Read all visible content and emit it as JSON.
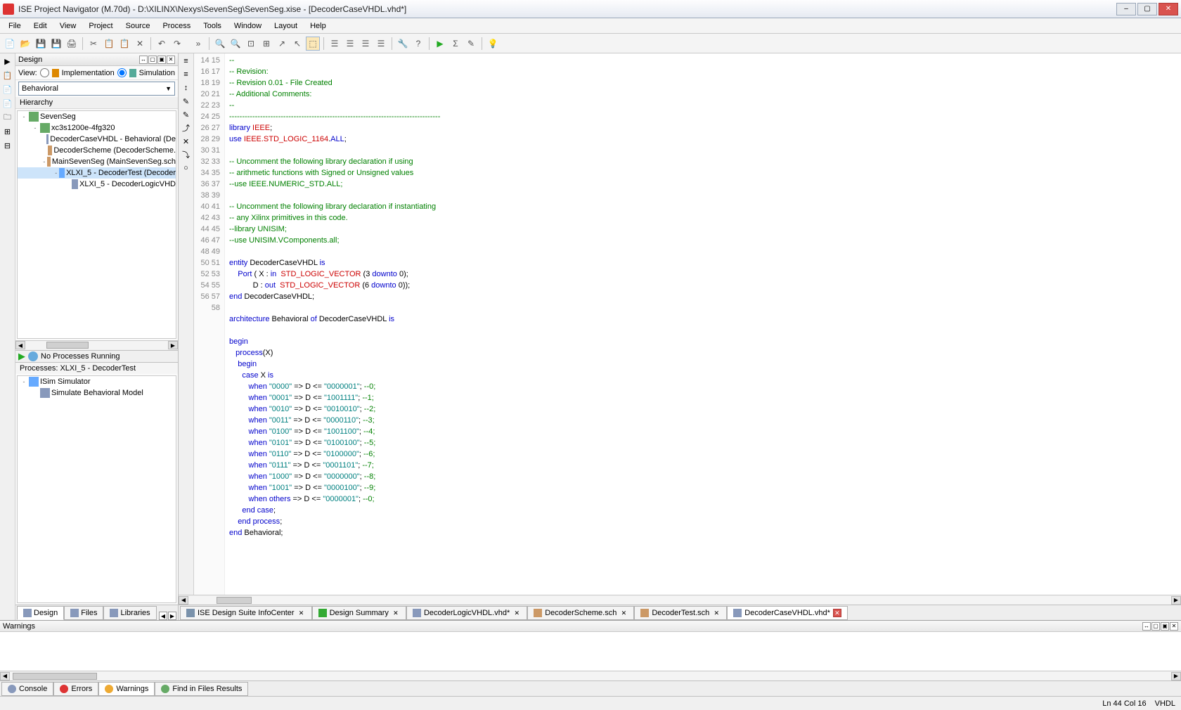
{
  "title": "ISE Project Navigator (M.70d) - D:\\XILINX\\Nexys\\SevenSeg\\SevenSeg.xise - [DecoderCaseVHDL.vhd*]",
  "menu": [
    "File",
    "Edit",
    "View",
    "Project",
    "Source",
    "Process",
    "Tools",
    "Window",
    "Layout",
    "Help"
  ],
  "design_panel": {
    "title": "Design",
    "view_label": "View:",
    "impl": "Implementation",
    "sim": "Simulation",
    "combo": "Behavioral",
    "hierarchy": "Hierarchy",
    "tree": [
      {
        "indent": 0,
        "exp": "-",
        "ico": "chip",
        "label": "SevenSeg"
      },
      {
        "indent": 1,
        "exp": "-",
        "ico": "chip",
        "label": "xc3s1200e-4fg320"
      },
      {
        "indent": 2,
        "exp": "",
        "ico": "doc",
        "label": "DecoderCaseVHDL - Behavioral (De"
      },
      {
        "indent": 2,
        "exp": "",
        "ico": "sch",
        "label": "DecoderScheme (DecoderScheme."
      },
      {
        "indent": 2,
        "exp": "-",
        "ico": "sch",
        "label": "MainSevenSeg (MainSevenSeg.sch"
      },
      {
        "indent": 3,
        "exp": "-",
        "ico": "mod",
        "label": "XLXI_5 - DecoderTest (Decoder",
        "sel": true
      },
      {
        "indent": 4,
        "exp": "",
        "ico": "doc",
        "label": "XLXI_5 - DecoderLogicVHD"
      }
    ],
    "no_proc": "No Processes Running",
    "proc_label": "Processes: XLXI_5 - DecoderTest",
    "proc_tree": [
      {
        "indent": 0,
        "exp": "-",
        "ico": "mod",
        "label": "ISim Simulator"
      },
      {
        "indent": 1,
        "exp": "",
        "ico": "doc",
        "label": "Simulate Behavioral Model"
      }
    ],
    "tabs": [
      "Design",
      "Files",
      "Libraries"
    ]
  },
  "code_lines": [
    {
      "n": 14,
      "t": "--",
      "cls": "cmt"
    },
    {
      "n": 15,
      "t": "-- Revision:",
      "cls": "cmt"
    },
    {
      "n": 16,
      "t": "-- Revision 0.01 - File Created",
      "cls": "cmt"
    },
    {
      "n": 17,
      "t": "-- Additional Comments:",
      "cls": "cmt"
    },
    {
      "n": 18,
      "t": "--",
      "cls": "cmt"
    },
    {
      "n": 19,
      "t": "----------------------------------------------------------------------------------",
      "cls": "cmt"
    },
    {
      "n": 20,
      "html": "<span class='kw'>library</span> <span class='lib'>IEEE</span>;"
    },
    {
      "n": 21,
      "html": "<span class='kw'>use</span> <span class='lib'>IEEE.STD_LOGIC_1164</span>.<span class='kw'>ALL</span>;"
    },
    {
      "n": 22,
      "t": ""
    },
    {
      "n": 23,
      "t": "-- Uncomment the following library declaration if using",
      "cls": "cmt"
    },
    {
      "n": 24,
      "t": "-- arithmetic functions with Signed or Unsigned values",
      "cls": "cmt"
    },
    {
      "n": 25,
      "t": "--use IEEE.NUMERIC_STD.ALL;",
      "cls": "cmt"
    },
    {
      "n": 26,
      "t": ""
    },
    {
      "n": 27,
      "t": "-- Uncomment the following library declaration if instantiating",
      "cls": "cmt"
    },
    {
      "n": 28,
      "t": "-- any Xilinx primitives in this code.",
      "cls": "cmt"
    },
    {
      "n": 29,
      "t": "--library UNISIM;",
      "cls": "cmt"
    },
    {
      "n": 30,
      "t": "--use UNISIM.VComponents.all;",
      "cls": "cmt"
    },
    {
      "n": 31,
      "t": ""
    },
    {
      "n": 32,
      "html": "<span class='kw'>entity</span> DecoderCaseVHDL <span class='kw'>is</span>"
    },
    {
      "n": 33,
      "html": "    <span class='kw'>Port</span> ( X : <span class='kw'>in</span>  <span class='typ'>STD_LOGIC_VECTOR</span> (3 <span class='kw'>downto</span> 0);"
    },
    {
      "n": 34,
      "html": "           D : <span class='kw'>out</span>  <span class='typ'>STD_LOGIC_VECTOR</span> (6 <span class='kw'>downto</span> 0));"
    },
    {
      "n": 35,
      "html": "<span class='kw'>end</span> DecoderCaseVHDL;"
    },
    {
      "n": 36,
      "t": ""
    },
    {
      "n": 37,
      "html": "<span class='kw'>architecture</span> Behavioral <span class='kw'>of</span> DecoderCaseVHDL <span class='kw'>is</span>"
    },
    {
      "n": 38,
      "t": ""
    },
    {
      "n": 39,
      "html": "<span class='kw'>begin</span>"
    },
    {
      "n": 40,
      "html": "   <span class='kw'>process</span>(X)"
    },
    {
      "n": 41,
      "html": "    <span class='kw'>begin</span>"
    },
    {
      "n": 42,
      "html": "      <span class='kw'>case</span> X <span class='kw'>is</span>"
    },
    {
      "n": 43,
      "html": "         <span class='kw'>when</span> <span class='str'>\"0000\"</span> =&gt; D &lt;= <span class='str'>\"0000001\"</span>; <span class='cmt'>--0;</span>"
    },
    {
      "n": 44,
      "html": "         <span class='kw'>when</span> <span class='str'>\"0001\"</span> =&gt; D &lt;= <span class='str'>\"1001111\"</span>; <span class='cmt'>--1;</span>"
    },
    {
      "n": 45,
      "html": "         <span class='kw'>when</span> <span class='str'>\"0010\"</span> =&gt; D &lt;= <span class='str'>\"0010010\"</span>; <span class='cmt'>--2;</span>"
    },
    {
      "n": 46,
      "html": "         <span class='kw'>when</span> <span class='str'>\"0011\"</span> =&gt; D &lt;= <span class='str'>\"0000110\"</span>; <span class='cmt'>--3;</span>"
    },
    {
      "n": 47,
      "html": "         <span class='kw'>when</span> <span class='str'>\"0100\"</span> =&gt; D &lt;= <span class='str'>\"1001100\"</span>; <span class='cmt'>--4;</span>"
    },
    {
      "n": 48,
      "html": "         <span class='kw'>when</span> <span class='str'>\"0101\"</span> =&gt; D &lt;= <span class='str'>\"0100100\"</span>; <span class='cmt'>--5;</span>"
    },
    {
      "n": 49,
      "html": "         <span class='kw'>when</span> <span class='str'>\"0110\"</span> =&gt; D &lt;= <span class='str'>\"0100000\"</span>; <span class='cmt'>--6;</span>"
    },
    {
      "n": 50,
      "html": "         <span class='kw'>when</span> <span class='str'>\"0111\"</span> =&gt; D &lt;= <span class='str'>\"0001101\"</span>; <span class='cmt'>--7;</span>"
    },
    {
      "n": 51,
      "html": "         <span class='kw'>when</span> <span class='str'>\"1000\"</span> =&gt; D &lt;= <span class='str'>\"0000000\"</span>; <span class='cmt'>--8;</span>"
    },
    {
      "n": 52,
      "html": "         <span class='kw'>when</span> <span class='str'>\"1001\"</span> =&gt; D &lt;= <span class='str'>\"0000100\"</span>; <span class='cmt'>--9;</span>"
    },
    {
      "n": 53,
      "html": "         <span class='kw'>when</span> <span class='kw'>others</span> =&gt; D &lt;= <span class='str'>\"0000001\"</span>; <span class='cmt'>--0;</span>"
    },
    {
      "n": 54,
      "html": "      <span class='kw'>end</span> <span class='kw'>case</span>;"
    },
    {
      "n": 55,
      "html": "    <span class='kw'>end</span> <span class='kw'>process</span>;"
    },
    {
      "n": 56,
      "html": "<span class='kw'>end</span> Behavioral;"
    },
    {
      "n": 57,
      "t": ""
    },
    {
      "n": 58,
      "t": ""
    }
  ],
  "editor_tabs": [
    {
      "label": "ISE Design Suite InfoCenter",
      "ico": "#7a92ab"
    },
    {
      "label": "Design Summary",
      "ico": "#3a3"
    },
    {
      "label": "DecoderLogicVHDL.vhd*",
      "ico": "#89b"
    },
    {
      "label": "DecoderScheme.sch",
      "ico": "#c96"
    },
    {
      "label": "DecoderTest.sch",
      "ico": "#c96"
    },
    {
      "label": "DecoderCaseVHDL.vhd*",
      "ico": "#89b",
      "active": true,
      "dirty": true
    }
  ],
  "bottom": {
    "title": "Warnings",
    "tabs": [
      {
        "label": "Console",
        "color": "#89b"
      },
      {
        "label": "Errors",
        "color": "#d33"
      },
      {
        "label": "Warnings",
        "color": "#ea3",
        "active": true
      },
      {
        "label": "Find in Files Results",
        "color": "#6a6"
      }
    ]
  },
  "status": {
    "pos": "Ln 44 Col 16",
    "lang": "VHDL"
  }
}
